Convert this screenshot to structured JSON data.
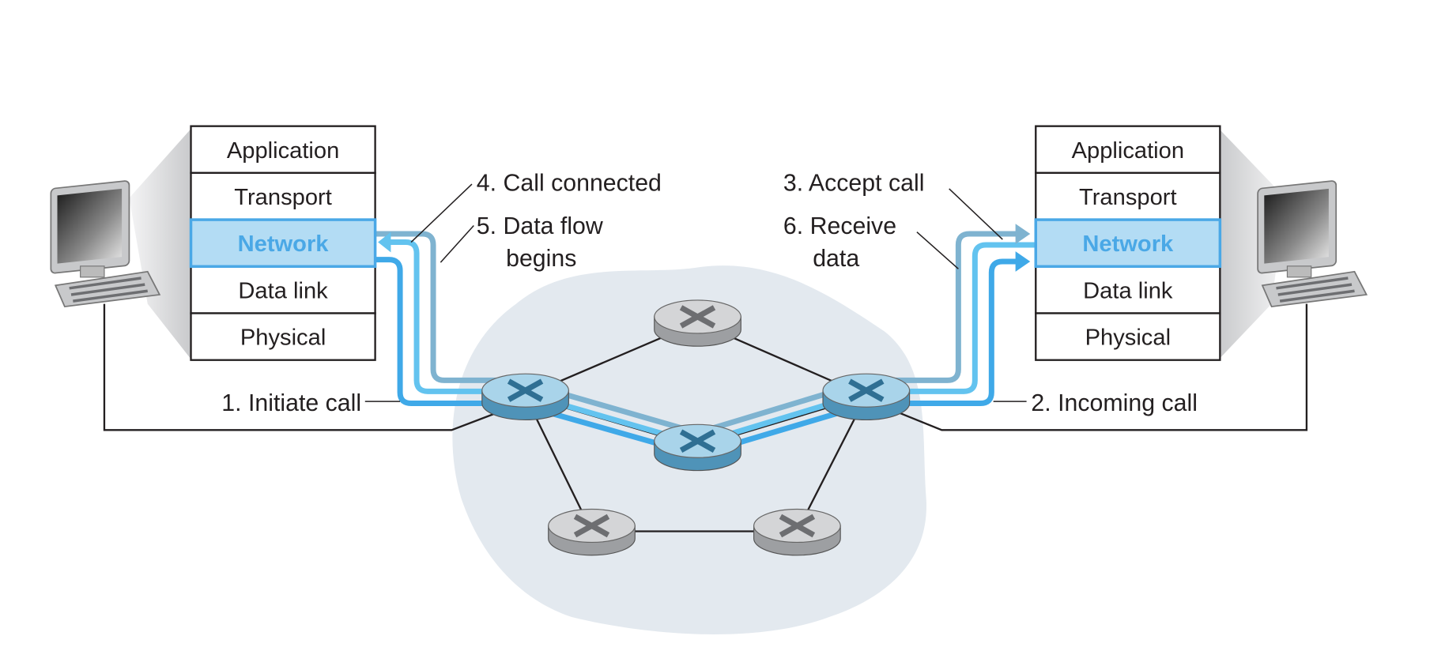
{
  "left_stack": {
    "layers": [
      "Application",
      "Transport",
      "Network",
      "Data link",
      "Physical"
    ],
    "highlighted": "Network"
  },
  "right_stack": {
    "layers": [
      "Application",
      "Transport",
      "Network",
      "Data link",
      "Physical"
    ],
    "highlighted": "Network"
  },
  "labels": {
    "step1": "1. Initiate call",
    "step2": "2. Incoming call",
    "step3": "3. Accept call",
    "step4": "4. Call connected",
    "step5_line1": "5. Data flow",
    "step5_line2": "begins",
    "step6_line1": "6. Receive",
    "step6_line2": "data"
  },
  "colors": {
    "highlight_fill": "#b3dcf4",
    "highlight_border": "#4aa8e6",
    "path_setup": "#7fb3d0",
    "path_connected": "#63c3ef",
    "path_data": "#3fa9e8",
    "cloud": "#e3e9ef"
  }
}
